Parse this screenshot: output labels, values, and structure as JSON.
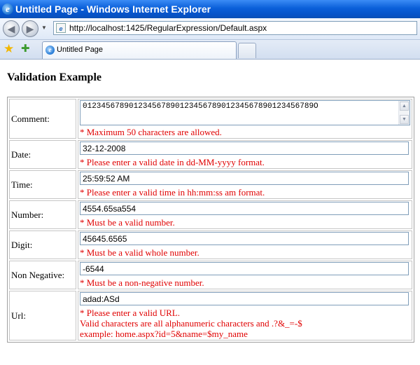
{
  "window": {
    "title": "Untitled Page - Windows Internet Explorer"
  },
  "address": {
    "url": "http://localhost:1425/RegularExpression/Default.aspx"
  },
  "tabs": [
    {
      "label": "Untitled Page"
    }
  ],
  "page": {
    "heading": "Validation Example",
    "rows": {
      "comment": {
        "label": "Comment:",
        "value": "01234567890123456789012345678901234567890123456789O",
        "errors": [
          "* Maximum 50 characters are allowed."
        ]
      },
      "date": {
        "label": "Date:",
        "value": "32-12-2008",
        "errors": [
          "* Please enter a valid date in dd-MM-yyyy format."
        ]
      },
      "time": {
        "label": "Time:",
        "value": "25:59:52 AM",
        "errors": [
          "* Please enter a valid time in hh:mm:ss am format."
        ]
      },
      "number": {
        "label": "Number:",
        "value": "4554.65sa554",
        "errors": [
          "* Must be a valid number."
        ]
      },
      "digit": {
        "label": "Digit:",
        "value": "45645.6565",
        "errors": [
          "* Must be a valid whole number."
        ]
      },
      "non_negative": {
        "label": "Non Negative:",
        "value": "-6544",
        "errors": [
          "* Must be a non-negative number."
        ]
      },
      "url": {
        "label": "Url:",
        "value": "adad:ASd",
        "errors": [
          "* Please enter a valid URL.",
          "Valid characters are all alphanumeric characters and .?&_=-$",
          "example: home.aspx?id=5&name=$my_name"
        ]
      }
    }
  },
  "colors": {
    "title_bar": "#0a5fd9",
    "error_text": "#e00000",
    "input_border": "#7f9db9"
  },
  "icons": [
    "ie-logo-icon",
    "back-icon",
    "forward-icon",
    "dropdown-arrow-icon",
    "page-icon",
    "favorites-star-icon",
    "add-favorites-icon",
    "tab-ie-icon",
    "scroll-up-icon",
    "scroll-down-icon"
  ]
}
